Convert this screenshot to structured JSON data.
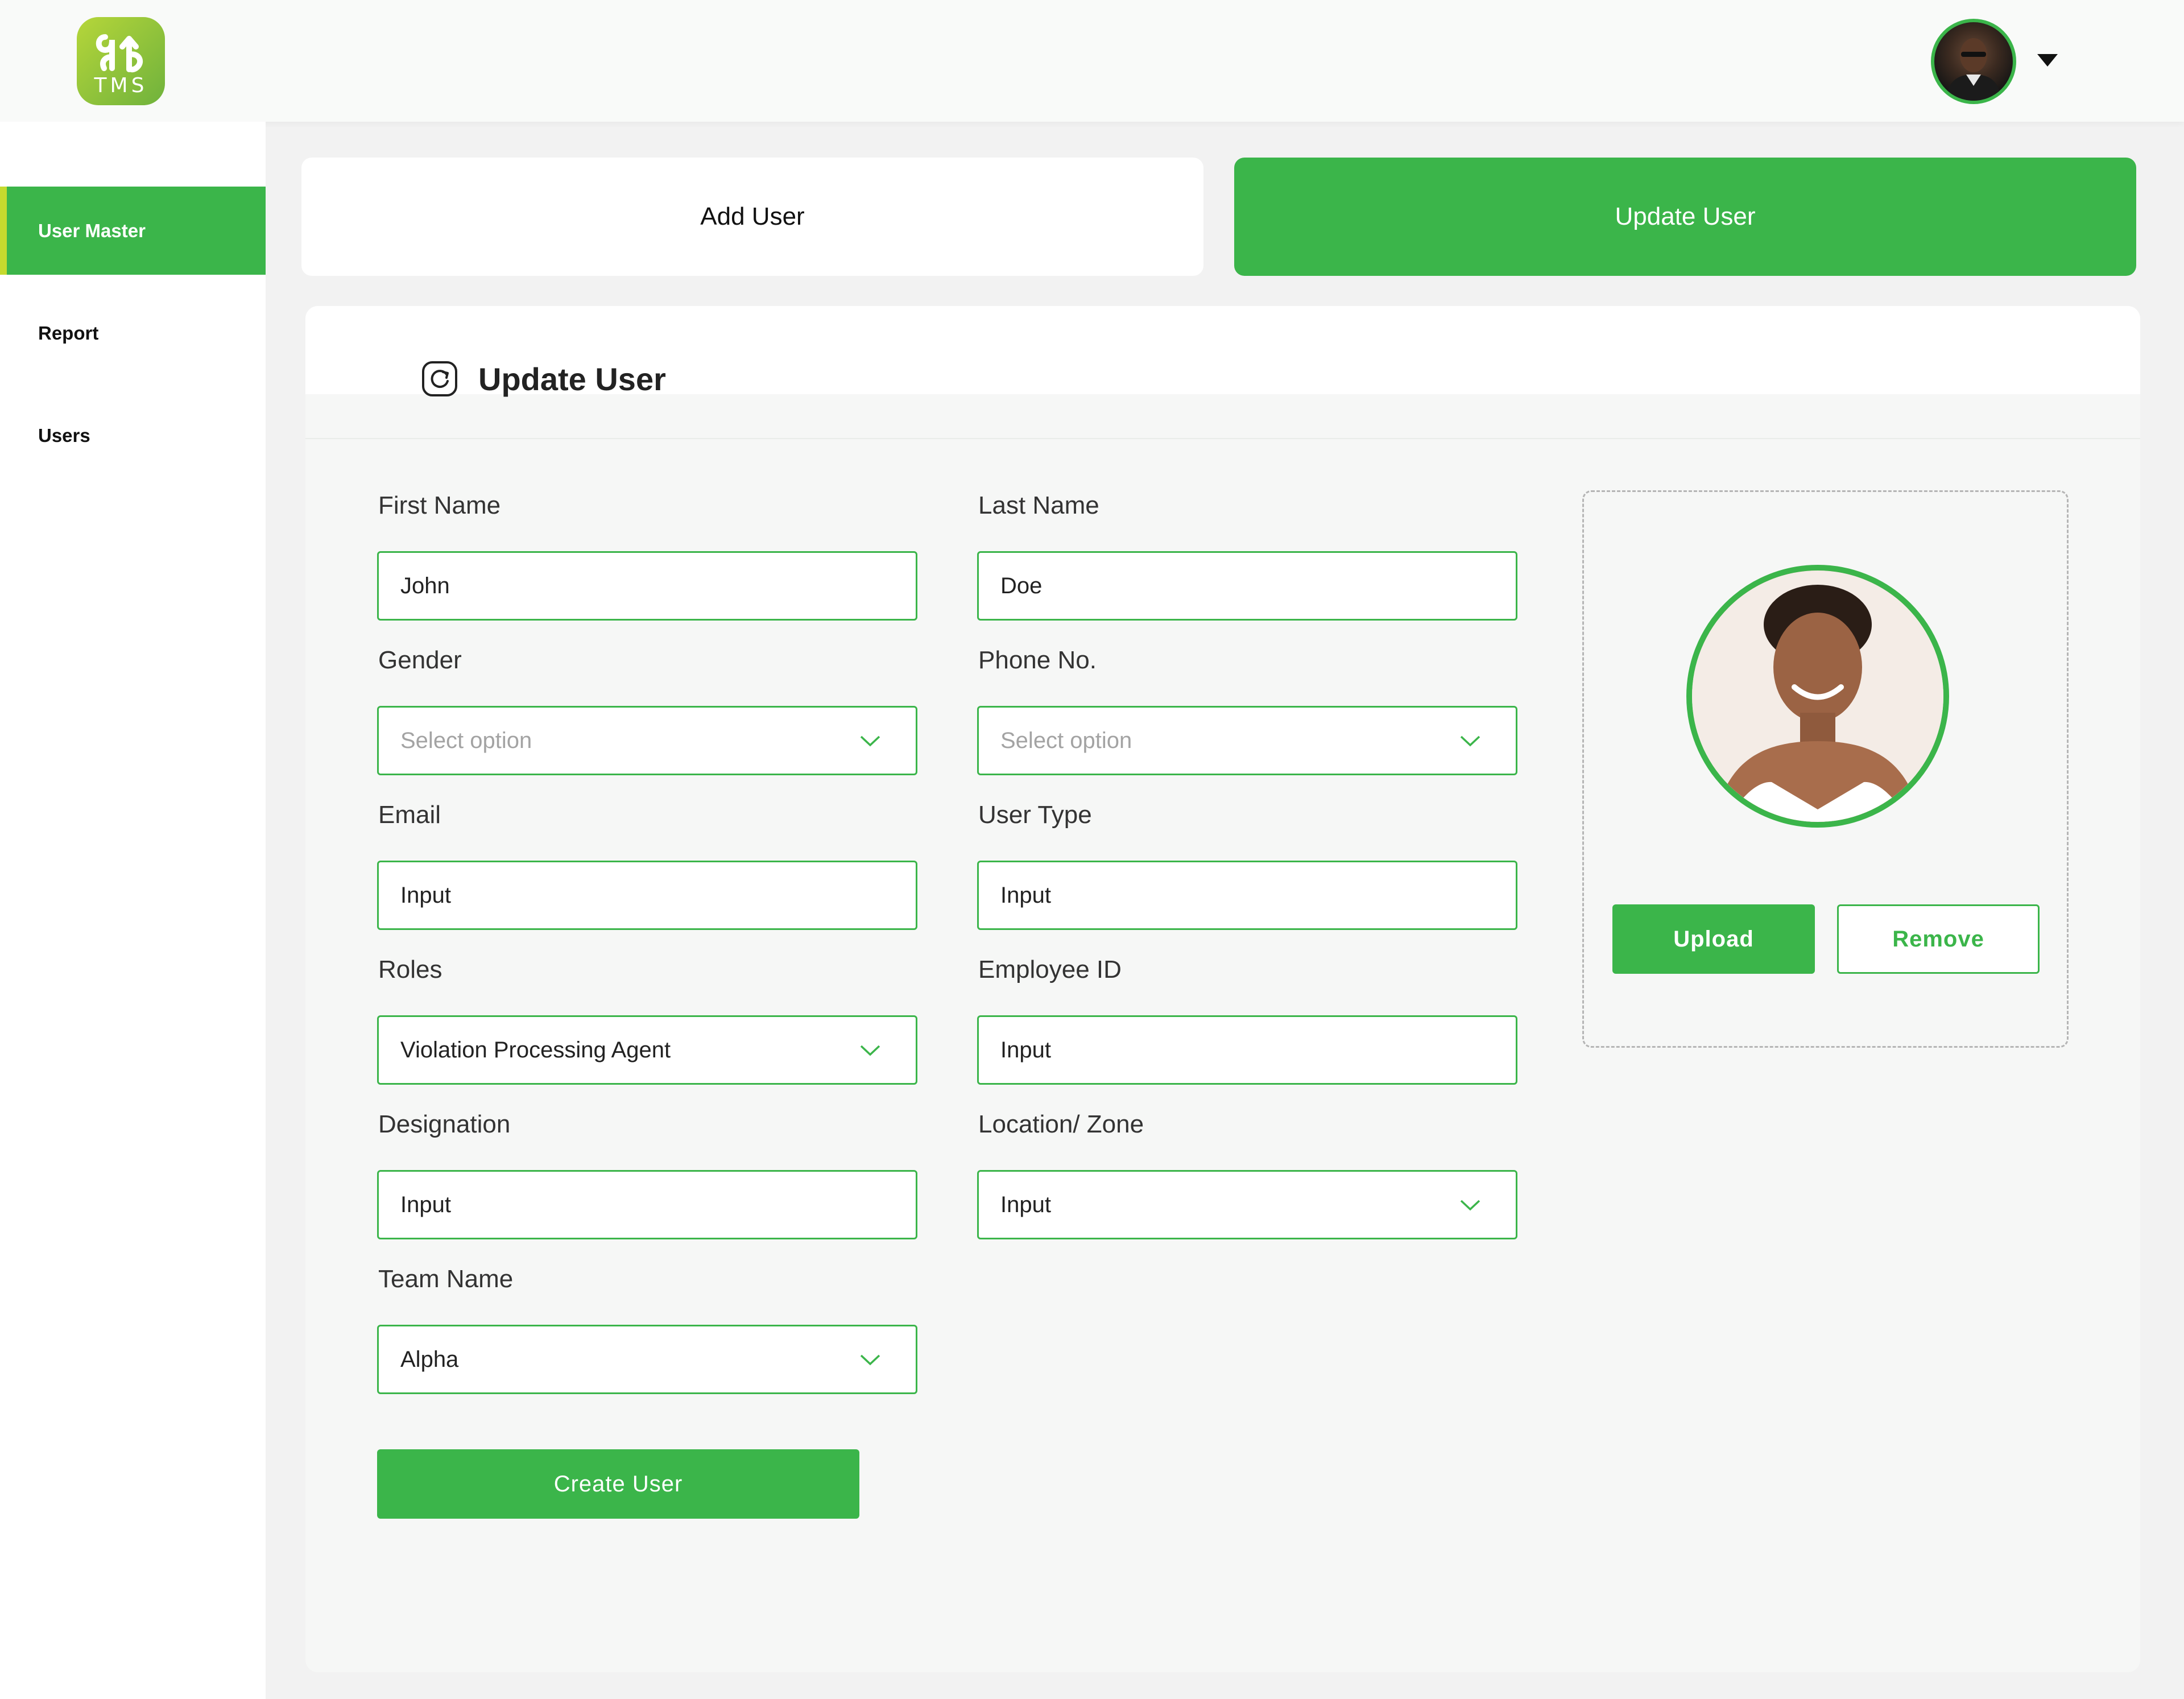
{
  "app": {
    "logo_text": "TMS"
  },
  "sidebar": {
    "items": [
      {
        "label": "User Master",
        "active": true
      },
      {
        "label": "Report",
        "active": false
      },
      {
        "label": "Users",
        "active": false
      }
    ]
  },
  "tabs": {
    "add": "Add User",
    "update": "Update User"
  },
  "panel": {
    "title": "Update User"
  },
  "form": {
    "first_name": {
      "label": "First Name",
      "value": "John"
    },
    "last_name": {
      "label": "Last Name",
      "value": "Doe"
    },
    "gender": {
      "label": "Gender",
      "placeholder": "Select option"
    },
    "phone": {
      "label": "Phone No.",
      "placeholder": "Select option"
    },
    "email": {
      "label": "Email",
      "value": "Input"
    },
    "user_type": {
      "label": "User Type",
      "value": "Input"
    },
    "roles": {
      "label": "Roles",
      "value": "Violation Processing Agent"
    },
    "employee_id": {
      "label": "Employee ID",
      "value": "Input"
    },
    "designation": {
      "label": "Designation",
      "value": "Input"
    },
    "location": {
      "label": "Location/ Zone",
      "value": "Input"
    },
    "team_name": {
      "label": "Team Name",
      "value": "Alpha"
    },
    "create_button": "Create User"
  },
  "photo": {
    "upload_button": "Upload",
    "remove_button": "Remove"
  },
  "colors": {
    "accent": "#3bb54a",
    "logo_lime": "#b6d63a",
    "sidebar_indicator": "#c5da2e"
  }
}
